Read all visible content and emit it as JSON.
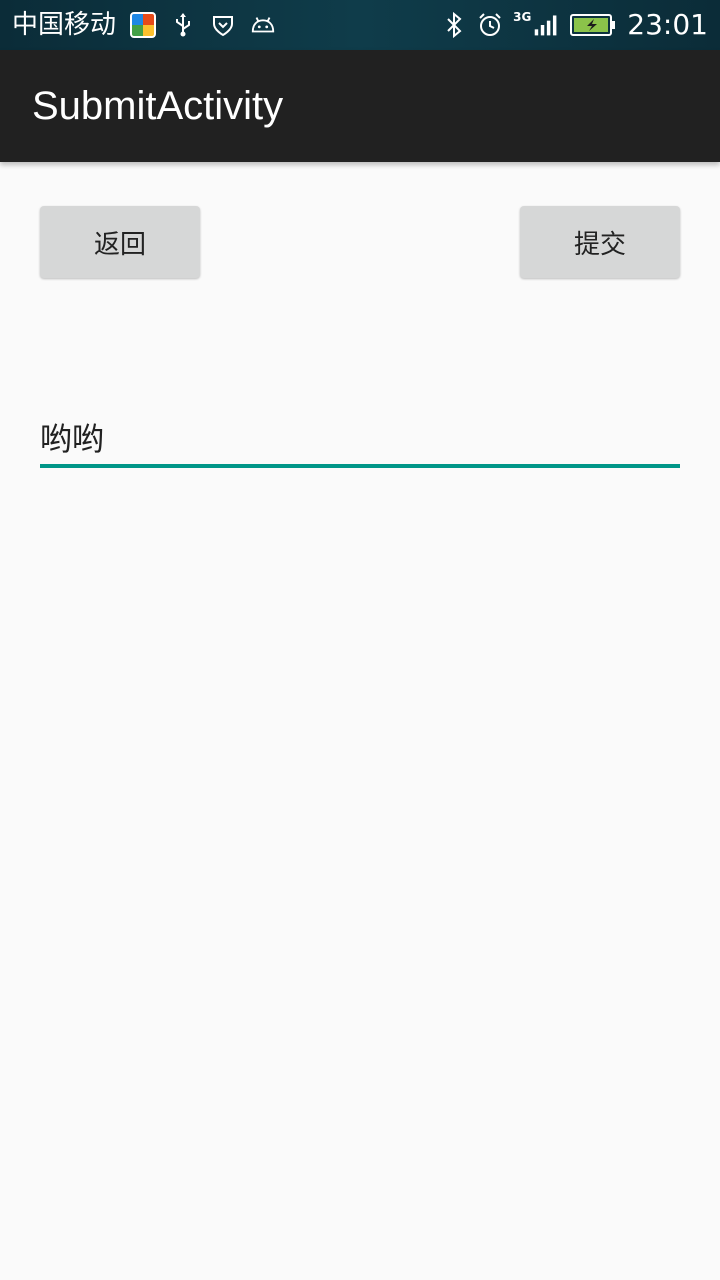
{
  "status_bar": {
    "carrier": "中国移动",
    "network_type": "3G",
    "time": "23:01",
    "icons": [
      "app-badge-icon",
      "usb-icon",
      "shield-icon",
      "android-icon",
      "bluetooth-icon",
      "alarm-icon",
      "signal-icon",
      "battery-icon"
    ]
  },
  "app_bar": {
    "title": "SubmitActivity"
  },
  "buttons": {
    "back_label": "返回",
    "submit_label": "提交"
  },
  "input": {
    "value": "哟哟"
  },
  "colors": {
    "accent": "#009688",
    "app_bar": "#212121",
    "button": "#d6d7d7",
    "background": "#fafafa"
  }
}
